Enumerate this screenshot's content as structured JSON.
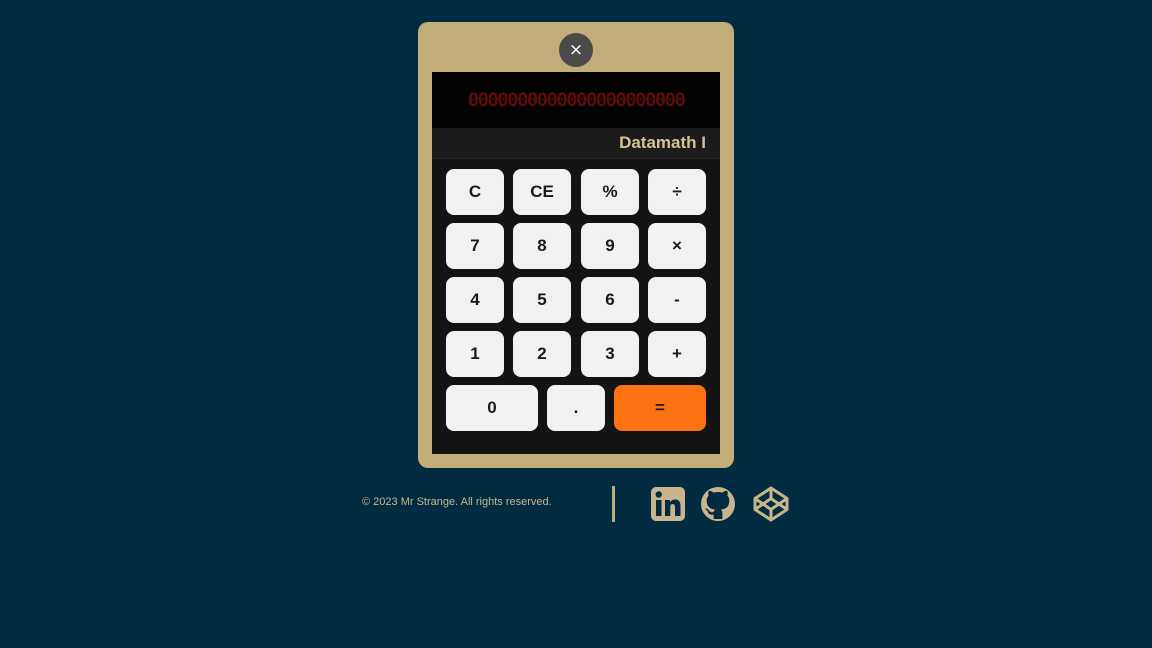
{
  "calculator": {
    "close_icon": "×",
    "display_value": "0000000000000000000000",
    "brand": "Datamath I",
    "keys": [
      "C",
      "CE",
      "%",
      "÷",
      "7",
      "8",
      "9",
      "×",
      "4",
      "5",
      "6",
      "-",
      "1",
      "2",
      "3",
      "+",
      "0",
      ".",
      "="
    ]
  },
  "footer": {
    "copyright": "© 2023 Mr Strange. All rights reserved.",
    "social_icons": [
      "linkedin-icon",
      "github-icon",
      "codepen-icon"
    ]
  },
  "colors": {
    "background": "#002b40",
    "frame": "#c2ac7a",
    "equals": "#fb7312",
    "digit": "#5c0a0a"
  }
}
